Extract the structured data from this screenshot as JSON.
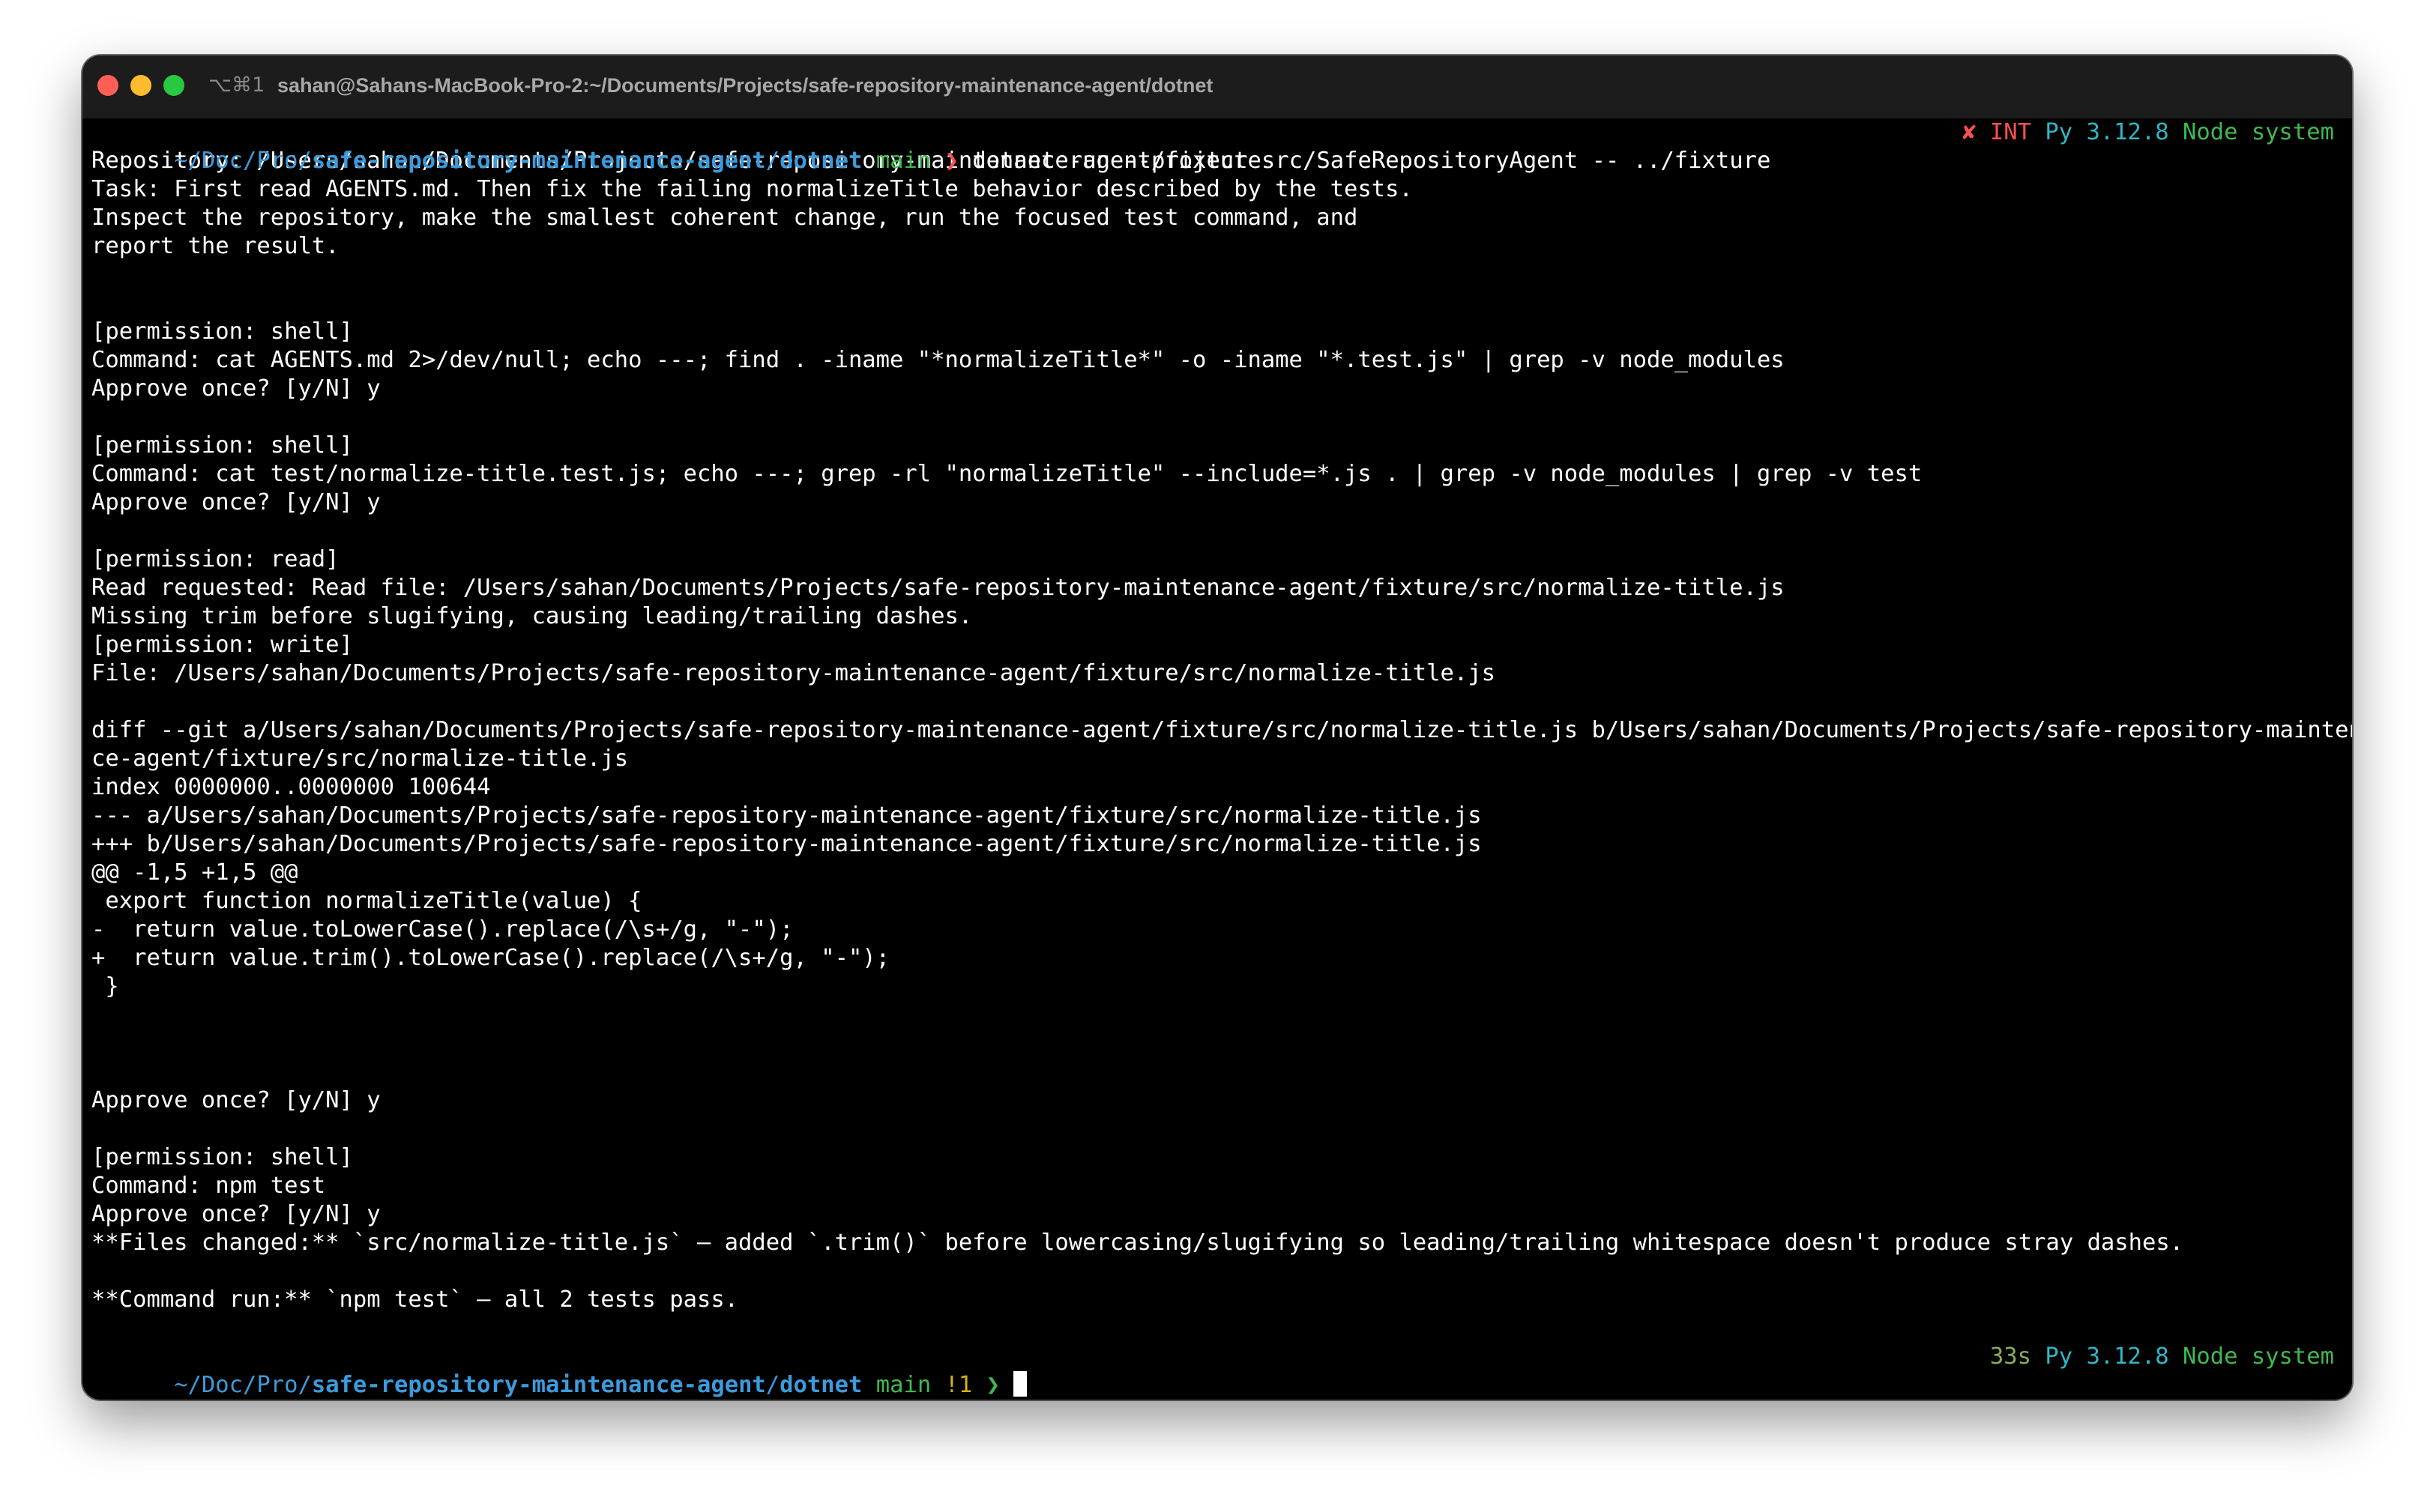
{
  "window": {
    "tab_shortcut": "⌥⌘1",
    "title": "sahan@Sahans-MacBook-Pro-2:~/Documents/Projects/safe-repository-maintenance-agent/dotnet"
  },
  "prompt1": {
    "path_dim": "~/Doc/Pro/",
    "path_repo": "safe-repository-maintenance-agent",
    "path_slash": "/",
    "path_dir": "dotnet",
    "branch": "main",
    "arrow": "❯",
    "command": "dotnet run --project src/SafeRepositoryAgent -- ../fixture",
    "status": "✘ INT",
    "python": "Py 3.12.8",
    "node": "Node system"
  },
  "output": [
    "Repository: /Users/sahan/Documents/Projects/safe-repository-maintenance-agent/fixture",
    "Task: First read AGENTS.md. Then fix the failing normalizeTitle behavior described by the tests.",
    "Inspect the repository, make the smallest coherent change, run the focused test command, and",
    "report the result.",
    "",
    "",
    "[permission: shell]",
    "Command: cat AGENTS.md 2>/dev/null; echo ---; find . -iname \"*normalizeTitle*\" -o -iname \"*.test.js\" | grep -v node_modules",
    "Approve once? [y/N] y",
    "",
    "[permission: shell]",
    "Command: cat test/normalize-title.test.js; echo ---; grep -rl \"normalizeTitle\" --include=*.js . | grep -v node_modules | grep -v test",
    "Approve once? [y/N] y",
    "",
    "[permission: read]",
    "Read requested: Read file: /Users/sahan/Documents/Projects/safe-repository-maintenance-agent/fixture/src/normalize-title.js",
    "Missing trim before slugifying, causing leading/trailing dashes.",
    "[permission: write]",
    "File: /Users/sahan/Documents/Projects/safe-repository-maintenance-agent/fixture/src/normalize-title.js",
    "",
    "diff --git a/Users/sahan/Documents/Projects/safe-repository-maintenance-agent/fixture/src/normalize-title.js b/Users/sahan/Documents/Projects/safe-repository-maintenan",
    "ce-agent/fixture/src/normalize-title.js",
    "index 0000000..0000000 100644",
    "--- a/Users/sahan/Documents/Projects/safe-repository-maintenance-agent/fixture/src/normalize-title.js",
    "+++ b/Users/sahan/Documents/Projects/safe-repository-maintenance-agent/fixture/src/normalize-title.js",
    "@@ -1,5 +1,5 @@",
    " export function normalizeTitle(value) {",
    "-  return value.toLowerCase().replace(/\\s+/g, \"-\");",
    "+  return value.trim().toLowerCase().replace(/\\s+/g, \"-\");",
    " }",
    "",
    "",
    "",
    "Approve once? [y/N] y",
    "",
    "[permission: shell]",
    "Command: npm test",
    "Approve once? [y/N] y",
    "**Files changed:** `src/normalize-title.js` — added `.trim()` before lowercasing/slugifying so leading/trailing whitespace doesn't produce stray dashes.",
    "",
    "**Command run:** `npm test` — all 2 tests pass.",
    ""
  ],
  "prompt2": {
    "path_dim": "~/Doc/Pro/",
    "path_repo": "safe-repository-maintenance-agent",
    "path_slash": "/",
    "path_dir": "dotnet",
    "branch": "main",
    "git_status": "!1",
    "arrow": "❯",
    "duration": "33s",
    "python": "Py 3.12.8",
    "node": "Node system"
  }
}
